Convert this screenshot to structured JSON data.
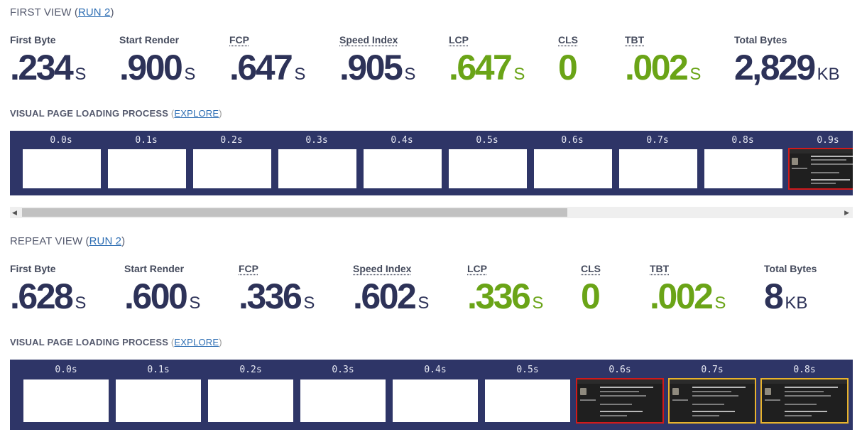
{
  "first_view": {
    "heading": "FIRST VIEW",
    "run_link": "RUN 2",
    "metrics": [
      {
        "label": "First Byte",
        "value": ".234",
        "unit": "S",
        "color": "#2d3258"
      },
      {
        "label": "Start Render",
        "value": ".900",
        "unit": "S",
        "color": "#2d3258"
      },
      {
        "label": "FCP",
        "value": ".647",
        "unit": "S",
        "color": "#2d3258"
      },
      {
        "label": "Speed Index",
        "value": ".905",
        "unit": "S",
        "color": "#2d3258"
      },
      {
        "label": "LCP",
        "value": ".647",
        "unit": "S",
        "color": "#6aa417"
      },
      {
        "label": "CLS",
        "value": "0",
        "unit": "",
        "color": "#6aa417"
      },
      {
        "label": "TBT",
        "value": ".002",
        "unit": "S",
        "color": "#6aa417"
      },
      {
        "label": "Total Bytes",
        "value": "2,829",
        "unit": "KB",
        "color": "#2d3258"
      }
    ],
    "visual_label": "VISUAL PAGE LOADING PROCESS",
    "explore_link": "EXPLORE",
    "frames": [
      "0.0s",
      "0.1s",
      "0.2s",
      "0.3s",
      "0.4s",
      "0.5s",
      "0.6s",
      "0.7s",
      "0.8s",
      "0.9s"
    ]
  },
  "repeat_view": {
    "heading": "REPEAT VIEW",
    "run_link": "RUN 2",
    "metrics": [
      {
        "label": "First Byte",
        "value": ".628",
        "unit": "S",
        "color": "#2d3258"
      },
      {
        "label": "Start Render",
        "value": ".600",
        "unit": "S",
        "color": "#2d3258"
      },
      {
        "label": "FCP",
        "value": ".336",
        "unit": "S",
        "color": "#2d3258"
      },
      {
        "label": "Speed Index",
        "value": ".602",
        "unit": "S",
        "color": "#2d3258"
      },
      {
        "label": "LCP",
        "value": ".336",
        "unit": "S",
        "color": "#6aa417"
      },
      {
        "label": "CLS",
        "value": "0",
        "unit": "",
        "color": "#6aa417"
      },
      {
        "label": "TBT",
        "value": ".002",
        "unit": "S",
        "color": "#6aa417"
      },
      {
        "label": "Total Bytes",
        "value": "8",
        "unit": "KB",
        "color": "#2d3258"
      }
    ],
    "visual_label": "VISUAL PAGE LOADING PROCESS",
    "explore_link": "EXPLORE",
    "frames": [
      "0.0s",
      "0.1s",
      "0.2s",
      "0.3s",
      "0.4s",
      "0.5s",
      "0.6s",
      "0.7s",
      "0.8s"
    ]
  },
  "colors": {
    "filmstrip_bg": "#2e3567",
    "metric_navy": "#2d3258",
    "metric_green": "#6aa417",
    "link": "#2f6fb4",
    "frame_changed_border": "#d11a1a",
    "frame_visual_change_border": "#e8b32c"
  }
}
